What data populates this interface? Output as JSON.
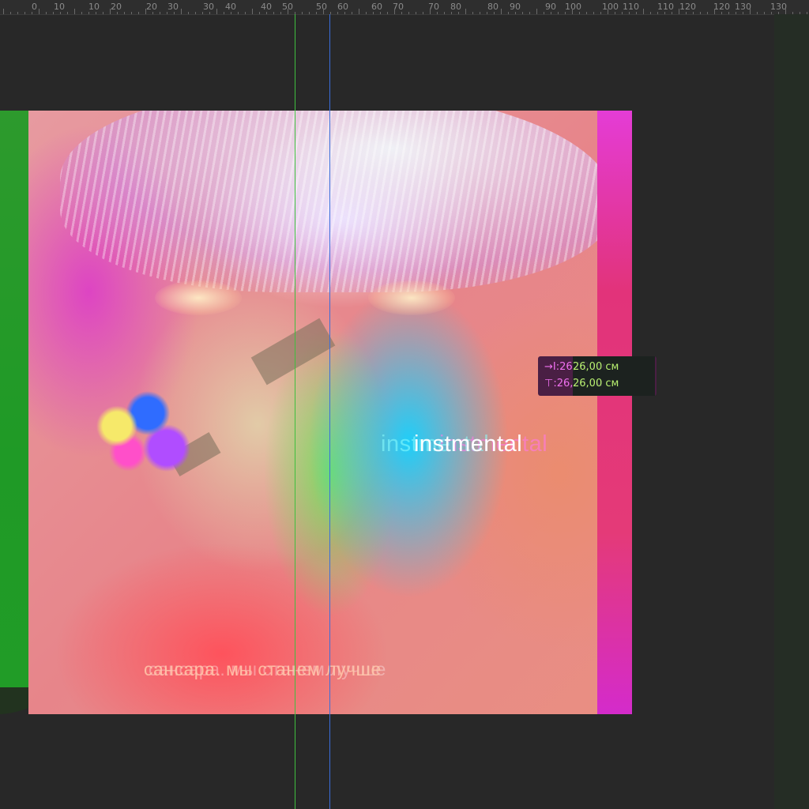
{
  "ruler": {
    "labels": [
      "0",
      "10",
      "10",
      "20",
      "20",
      "30",
      "30",
      "40",
      "40",
      "50",
      "50",
      "60",
      "60",
      "70",
      "70",
      "80",
      "80",
      "90",
      "90",
      "100",
      "100",
      "110",
      "110",
      "120",
      "120",
      "130",
      "130"
    ]
  },
  "artwork": {
    "title": "instmental",
    "subtitle": "сансара. мы станем лучше"
  },
  "dimensions_tooltip": {
    "width_icon": "→I",
    "height_icon": "⊤",
    "width": "26,00 см",
    "height": "26,00 см"
  },
  "colors": {
    "canvas_background": "#282828",
    "guide_green": "#3fbf3f",
    "guide_blue": "#3a6edb",
    "tooltip_text": "#f070f0"
  }
}
